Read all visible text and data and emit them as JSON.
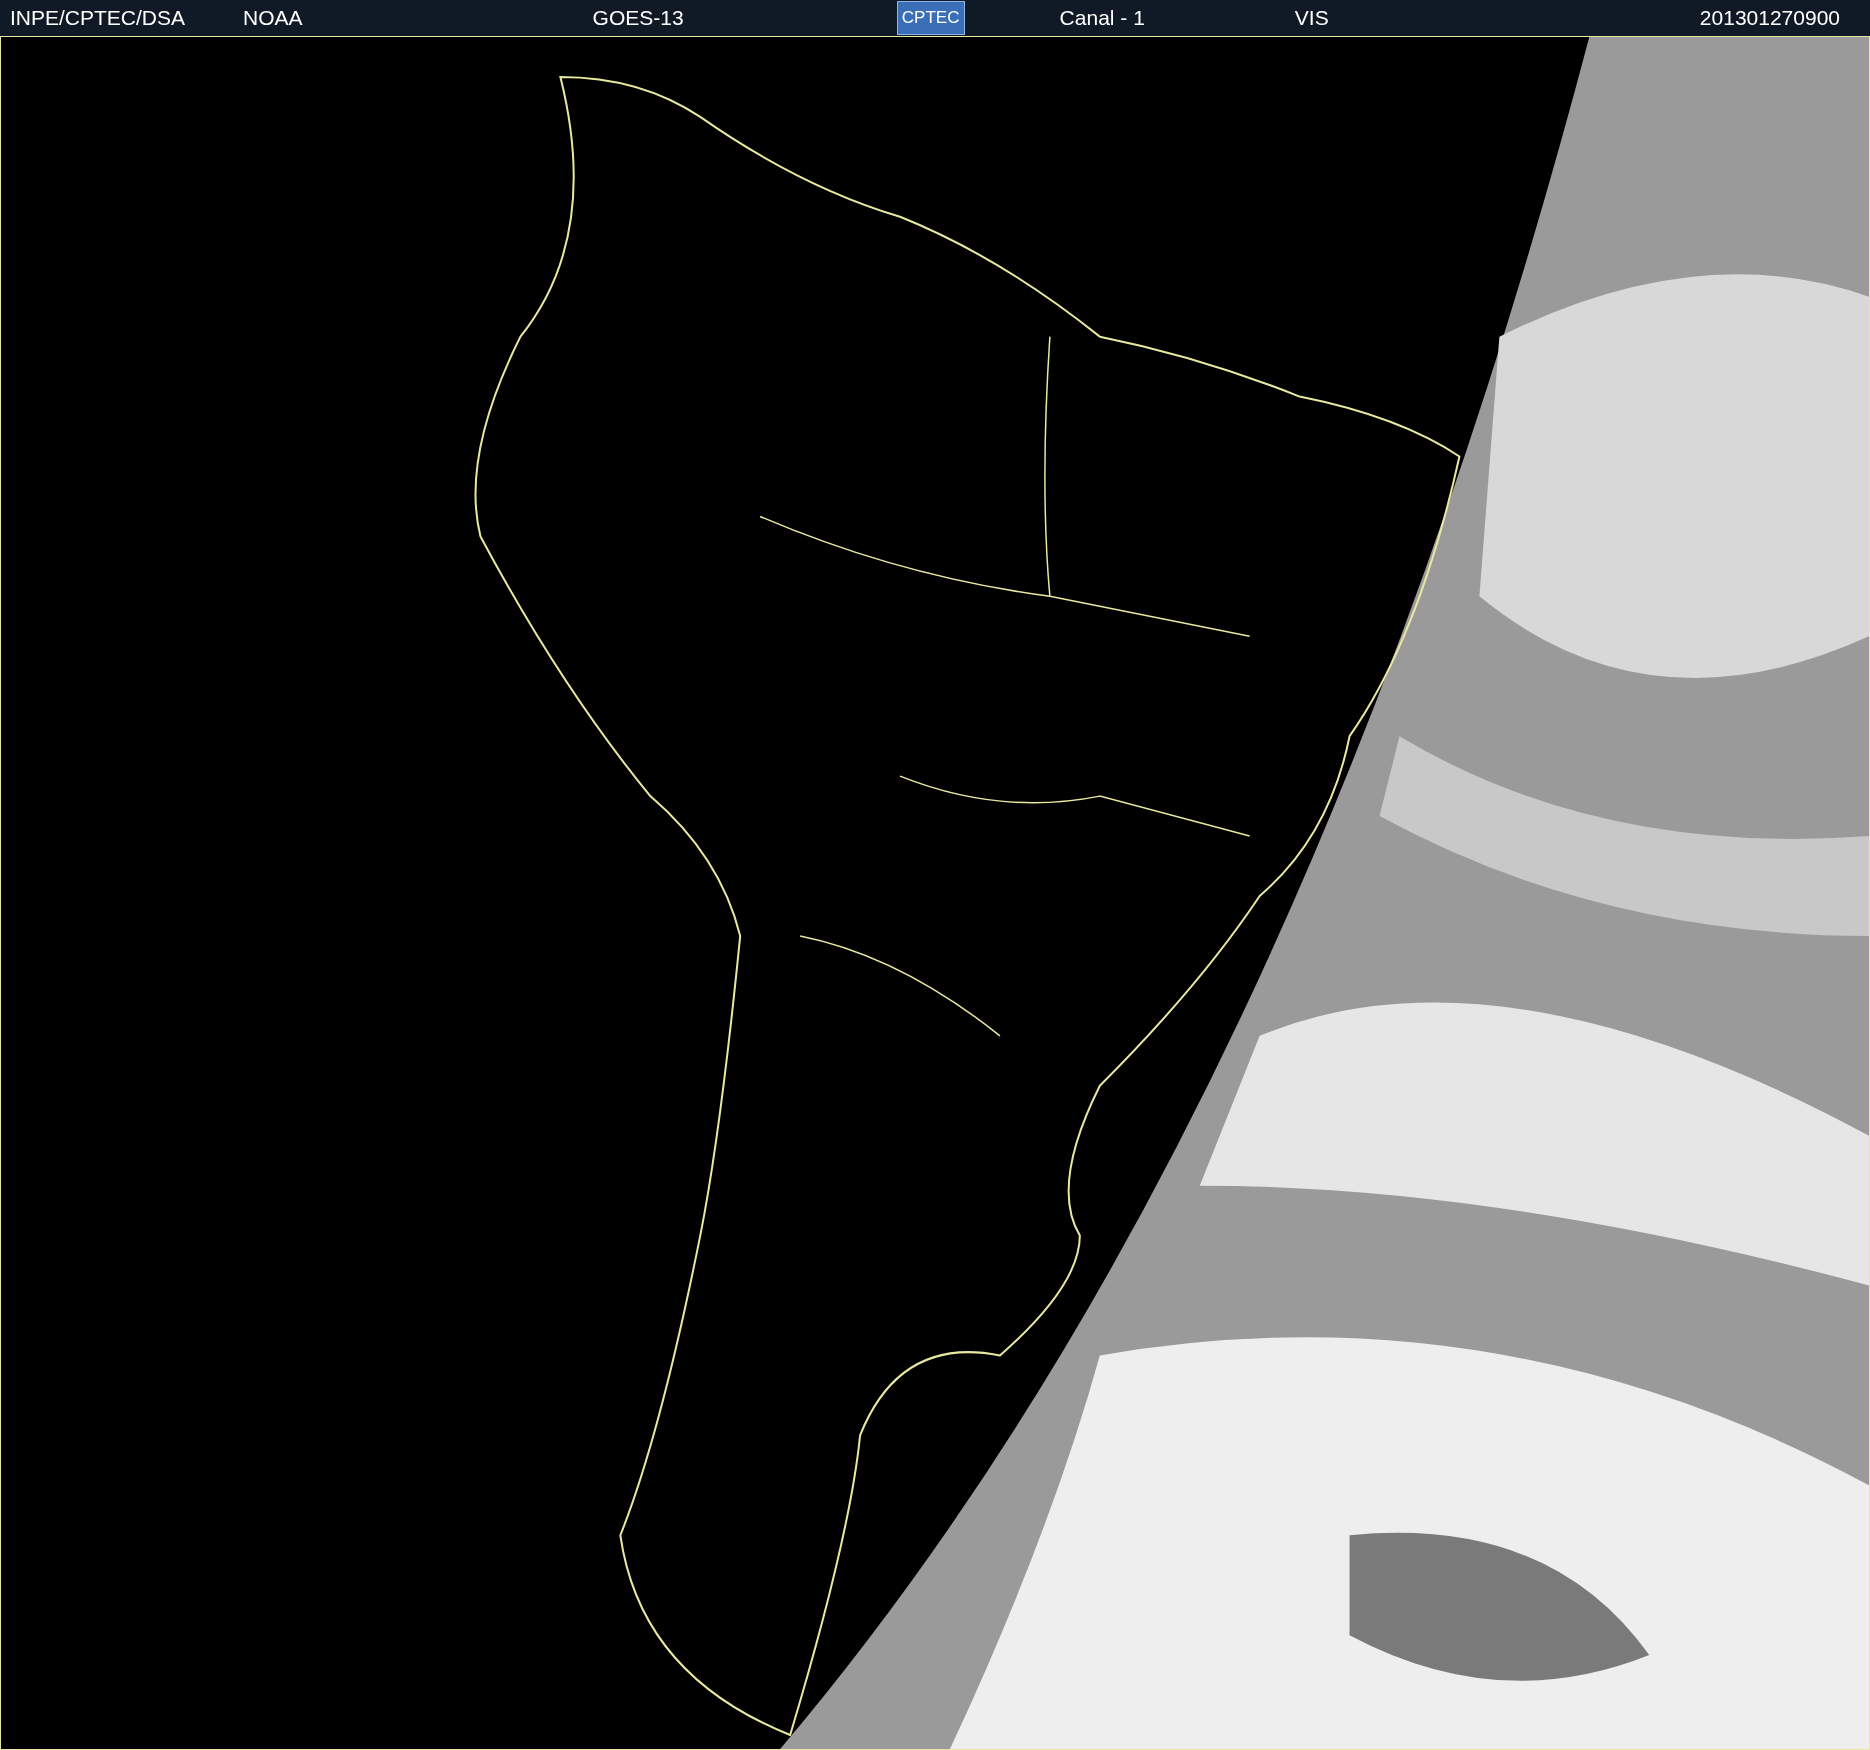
{
  "header": {
    "institution": "INPE/CPTEC/DSA",
    "agency": "NOAA",
    "satellite": "GOES-13",
    "logo": "CPTEC",
    "channel": "Canal - 1",
    "band": "VIS",
    "timestamp": "201301270900"
  }
}
